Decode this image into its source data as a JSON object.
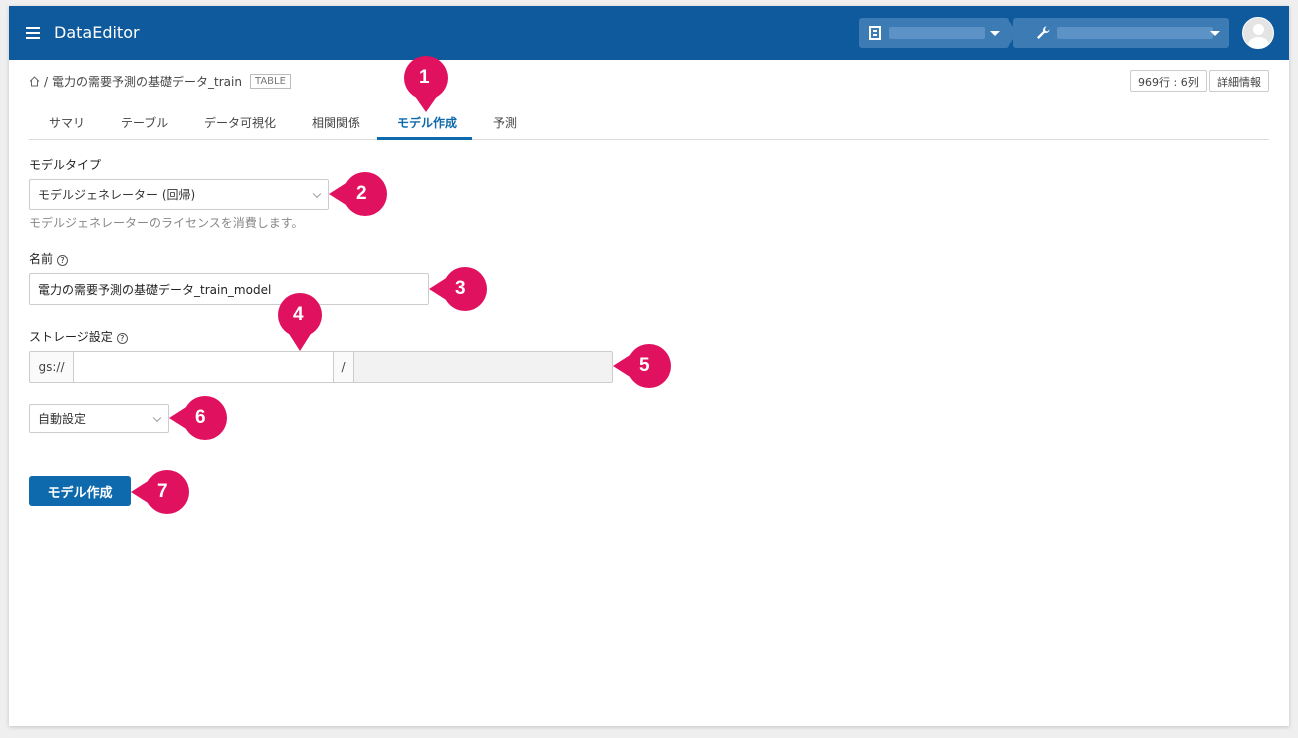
{
  "header": {
    "app_title": "DataEditor",
    "tenant_icon": "building-icon",
    "project_icon": "wrench-icon",
    "avatar_icon": "user-avatar-icon"
  },
  "breadcrumb": {
    "separator": "/",
    "dataset_name": "電力の需要予測の基礎データ_train",
    "type_badge": "TABLE"
  },
  "table_meta": {
    "row_col": "969行 : 6列",
    "detail_label": "詳細情報"
  },
  "tabs": [
    {
      "label": "サマリ"
    },
    {
      "label": "テーブル"
    },
    {
      "label": "データ可視化"
    },
    {
      "label": "相関関係"
    },
    {
      "label": "モデル作成",
      "active": true
    },
    {
      "label": "予測"
    }
  ],
  "form": {
    "model_type_label": "モデルタイプ",
    "model_type_value": "モデルジェネレーター (回帰)",
    "model_type_help": "モデルジェネレーターのライセンスを消費します。",
    "name_label": "名前",
    "name_value": "電力の需要予測の基礎データ_train_model",
    "storage_label": "ストレージ設定",
    "storage_prefix": "gs://",
    "storage_bucket_value": "",
    "storage_separator": "/",
    "storage_path_value": "",
    "auto_setting_value": "自動設定",
    "help_symbol": "?",
    "submit_label": "モデル作成"
  },
  "callouts": [
    "1",
    "2",
    "3",
    "4",
    "5",
    "6",
    "7"
  ],
  "colors": {
    "header_bg": "#0e5a9c",
    "accent": "#0e6aad",
    "callout": "#e0115f"
  }
}
